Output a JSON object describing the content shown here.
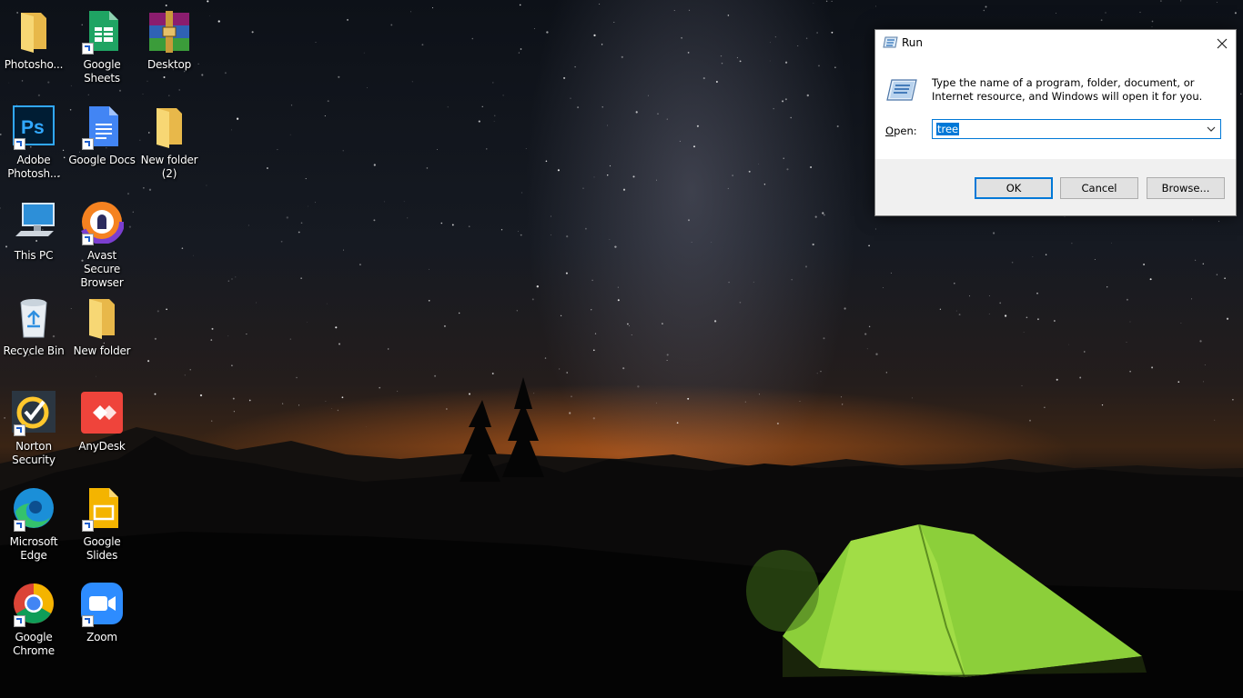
{
  "desktop": {
    "icons": [
      {
        "label": "Photosho...",
        "icon": "folder-icon"
      },
      {
        "label": "Google\nSheets",
        "icon": "google-sheets-icon"
      },
      {
        "label": "Desktop",
        "icon": "winrar-archive-icon"
      },
      {
        "label": "Adobe\nPhotosh...",
        "icon": "photoshop-icon"
      },
      {
        "label": "Google Docs",
        "icon": "google-docs-icon"
      },
      {
        "label": "New folder\n(2)",
        "icon": "folder-icon"
      },
      {
        "label": "This PC",
        "icon": "computer-icon"
      },
      {
        "label": "Avast Secure\nBrowser",
        "icon": "avast-browser-icon"
      },
      {
        "label": "Recycle Bin",
        "icon": "recycle-bin-icon"
      },
      {
        "label": "New folder",
        "icon": "folder-icon"
      },
      {
        "label": "Norton\nSecurity",
        "icon": "norton-icon"
      },
      {
        "label": "AnyDesk",
        "icon": "anydesk-icon"
      },
      {
        "label": "Microsoft\nEdge",
        "icon": "edge-icon"
      },
      {
        "label": "Google Slides",
        "icon": "google-slides-icon"
      },
      {
        "label": "Google\nChrome",
        "icon": "chrome-icon"
      },
      {
        "label": "Zoom",
        "icon": "zoom-icon"
      }
    ]
  },
  "run_dialog": {
    "title": "Run",
    "description": "Type the name of a program, folder, document, or Internet resource, and Windows will open it for you.",
    "open_label_prefix": "",
    "open_label_underlined": "O",
    "open_label_rest": "pen:",
    "open_value": "tree",
    "ok_label": "OK",
    "cancel_label": "Cancel",
    "browse_label": "Browse...",
    "accent_color": "#0078d7"
  }
}
